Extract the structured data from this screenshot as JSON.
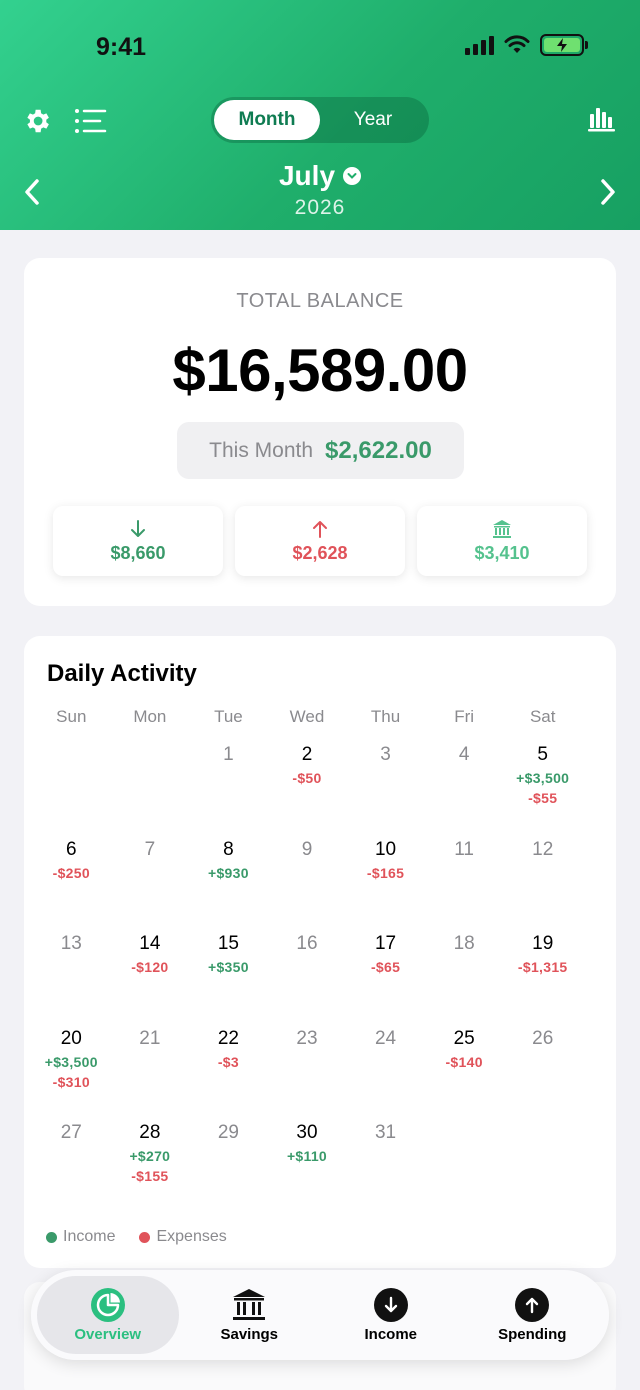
{
  "status_bar": {
    "time": "9:41"
  },
  "header": {
    "segment": {
      "month_label": "Month",
      "year_label": "Year",
      "selected": "Month"
    },
    "month": "July",
    "year": "2026"
  },
  "balance": {
    "label": "TOTAL BALANCE",
    "value": "$16,589.00",
    "this_month_label": "This Month",
    "this_month_value": "$2,622.00",
    "stats": [
      {
        "icon": "arrow-down-icon",
        "value": "$8,660",
        "color": "#3a9a6a"
      },
      {
        "icon": "arrow-up-icon",
        "value": "$2,628",
        "color": "#e0535a"
      },
      {
        "icon": "bank-icon",
        "value": "$3,410",
        "color": "#55c28e"
      }
    ]
  },
  "calendar": {
    "title": "Daily Activity",
    "weekdays": [
      "Sun",
      "Mon",
      "Tue",
      "Wed",
      "Thu",
      "Fri",
      "Sat"
    ],
    "days": [
      {
        "d": "",
        "inc": "",
        "exp": ""
      },
      {
        "d": "",
        "inc": "",
        "exp": ""
      },
      {
        "d": "1",
        "inc": "",
        "exp": ""
      },
      {
        "d": "2",
        "inc": "",
        "exp": "-$50"
      },
      {
        "d": "3",
        "inc": "",
        "exp": ""
      },
      {
        "d": "4",
        "inc": "",
        "exp": ""
      },
      {
        "d": "5",
        "inc": "+$3,500",
        "exp": "-$55"
      },
      {
        "d": "6",
        "inc": "",
        "exp": "-$250"
      },
      {
        "d": "7",
        "inc": "",
        "exp": ""
      },
      {
        "d": "8",
        "inc": "+$930",
        "exp": ""
      },
      {
        "d": "9",
        "inc": "",
        "exp": ""
      },
      {
        "d": "10",
        "inc": "",
        "exp": "-$165"
      },
      {
        "d": "11",
        "inc": "",
        "exp": ""
      },
      {
        "d": "12",
        "inc": "",
        "exp": ""
      },
      {
        "d": "13",
        "inc": "",
        "exp": ""
      },
      {
        "d": "14",
        "inc": "",
        "exp": "-$120"
      },
      {
        "d": "15",
        "inc": "+$350",
        "exp": ""
      },
      {
        "d": "16",
        "inc": "",
        "exp": ""
      },
      {
        "d": "17",
        "inc": "",
        "exp": "-$65"
      },
      {
        "d": "18",
        "inc": "",
        "exp": ""
      },
      {
        "d": "19",
        "inc": "",
        "exp": "-$1,315"
      },
      {
        "d": "20",
        "inc": "+$3,500",
        "exp": "-$310"
      },
      {
        "d": "21",
        "inc": "",
        "exp": ""
      },
      {
        "d": "22",
        "inc": "",
        "exp": "-$3"
      },
      {
        "d": "23",
        "inc": "",
        "exp": ""
      },
      {
        "d": "24",
        "inc": "",
        "exp": ""
      },
      {
        "d": "25",
        "inc": "",
        "exp": "-$140"
      },
      {
        "d": "26",
        "inc": "",
        "exp": ""
      },
      {
        "d": "27",
        "inc": "",
        "exp": ""
      },
      {
        "d": "28",
        "inc": "+$270",
        "exp": "-$155"
      },
      {
        "d": "29",
        "inc": "",
        "exp": ""
      },
      {
        "d": "30",
        "inc": "+$110",
        "exp": ""
      },
      {
        "d": "31",
        "inc": "",
        "exp": ""
      }
    ],
    "legend": {
      "income": "Income",
      "expenses": "Expenses"
    },
    "colors": {
      "income": "#3a9a6a",
      "expenses": "#e0535a"
    }
  },
  "tabbar": {
    "items": [
      {
        "label": "Overview",
        "icon": "pie-chart-icon",
        "active": true
      },
      {
        "label": "Savings",
        "icon": "bank-icon",
        "active": false
      },
      {
        "label": "Income",
        "icon": "arrow-down-circle-icon",
        "active": false
      },
      {
        "label": "Spending",
        "icon": "arrow-up-circle-icon",
        "active": false
      }
    ]
  },
  "theme": {
    "accent": "#2bbf80",
    "header_start": "#33d18f",
    "header_end": "#17a062"
  }
}
